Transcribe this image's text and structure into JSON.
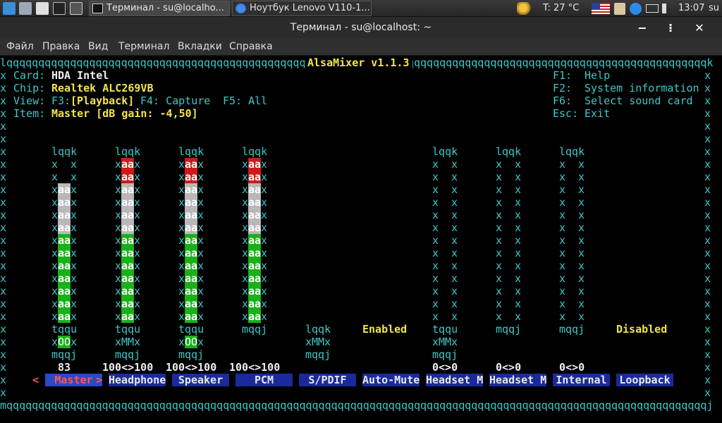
{
  "taskbar": {
    "tasks": [
      {
        "label": "Терминал - su@localho...",
        "active": true
      },
      {
        "label": "Ноутбук Lenovo V110-1...",
        "active": false
      }
    ],
    "temperature": "T: 27 °C",
    "clock": "13:07",
    "user": "su"
  },
  "window": {
    "title": "Терминал - su@localhost: ~",
    "buttons": {
      "minimize": "−",
      "maximize": "⁝",
      "close": "✕"
    }
  },
  "menu": [
    "Файл",
    "Правка",
    "Вид",
    "Терминал",
    "Вкладки",
    "Справка"
  ],
  "alsamixer": {
    "title": "AlsaMixer v1.1.3",
    "card_label": "Card:",
    "card": "HDA Intel",
    "chip_label": "Chip:",
    "chip": "Realtek ALC269VB",
    "view_label": "View:",
    "view_f3": "F3:",
    "view_playback": "[Playback]",
    "view_f4": "F4: Capture",
    "view_f5": "F5: All",
    "item_label": "Item:",
    "item": "Master [dB gain: -4,50]",
    "help": [
      {
        "key": "F1:",
        "text": "Help"
      },
      {
        "key": "F2:",
        "text": "System information"
      },
      {
        "key": "F6:",
        "text": "Select sound card"
      },
      {
        "key": "Esc:",
        "text": "Exit"
      }
    ],
    "channels": [
      {
        "name": "Master",
        "value_text": "83",
        "level": 0.83,
        "mute_text": "OO",
        "selected": true,
        "type": "mono"
      },
      {
        "name": "Headphone",
        "value_text": "100<>100",
        "level": 1.0,
        "mute_text": "MM",
        "selected": false,
        "type": "stereo"
      },
      {
        "name": "Speaker",
        "value_text": "100<>100",
        "level": 1.0,
        "mute_text": "OO",
        "selected": false,
        "type": "stereo"
      },
      {
        "name": "PCM",
        "value_text": "100<>100",
        "level": 1.0,
        "mute_text": "",
        "selected": false,
        "type": "stereo"
      },
      {
        "name": "S/PDIF",
        "value_text": "",
        "level": 0,
        "mute_text": "MM",
        "selected": false,
        "type": "switch"
      },
      {
        "name": "Auto-Mute",
        "value_text": "Enabled",
        "level": 0,
        "mute_text": "",
        "selected": false,
        "type": "enum"
      },
      {
        "name": "Headset M",
        "value_text": "0<>0",
        "level": 0,
        "mute_text": "MM",
        "selected": false,
        "type": "stereo"
      },
      {
        "name": "Headset M",
        "value_text": "0<>0",
        "level": 0,
        "mute_text": "",
        "selected": false,
        "type": "stereo"
      },
      {
        "name": "Internal",
        "value_text": "0<>0",
        "level": 0,
        "mute_text": "",
        "selected": false,
        "type": "stereo"
      },
      {
        "name": "Loopback",
        "value_text": "Disabled",
        "level": 0,
        "mute_text": "",
        "selected": false,
        "type": "enum"
      }
    ],
    "colors": {
      "border": "#3fc7c7",
      "bar_green": "#19b119",
      "bar_white": "#b8b8b8",
      "bar_red": "#cc1a1a",
      "label_bg": "#1a2a9c",
      "label_sel_bg": "#2a48c8",
      "selected_text": "#ff5555",
      "value_yellow": "#f2e64b"
    },
    "selector_left": "<",
    "selector_right": ">"
  }
}
